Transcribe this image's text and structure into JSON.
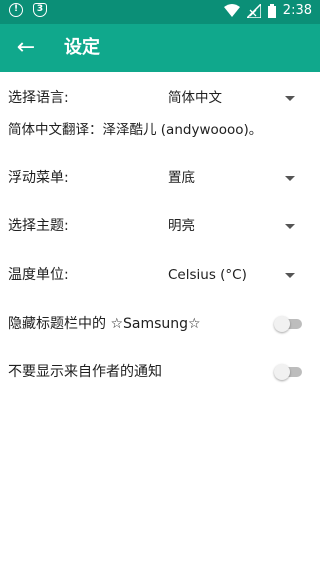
{
  "status": {
    "time": "2:38",
    "left_icons": [
      "alert-icon",
      "shield-icon"
    ],
    "right_icons": [
      "wifi-icon",
      "signal-icon",
      "battery-icon"
    ]
  },
  "appbar": {
    "title": "设定",
    "back_icon": "arrow-left-icon",
    "color": "#10a88c",
    "status_color": "#0b8f77"
  },
  "settings": {
    "language": {
      "label": "选择语言:",
      "value": "简体中文"
    },
    "translation_note": "简体中文翻译：泽泽酷儿 (andywoooo)。",
    "floating_menu": {
      "label": "浮动菜单:",
      "value": "置底"
    },
    "theme": {
      "label": "选择主题:",
      "value": "明亮"
    },
    "temperature": {
      "label": "温度单位:",
      "value": "Celsius (°C)"
    },
    "hide_samsung": {
      "label": "隐藏标题栏中的 ☆Samsung☆",
      "enabled": false
    },
    "hide_notifications": {
      "label": "不要显示来自作者的通知",
      "enabled": false
    }
  }
}
